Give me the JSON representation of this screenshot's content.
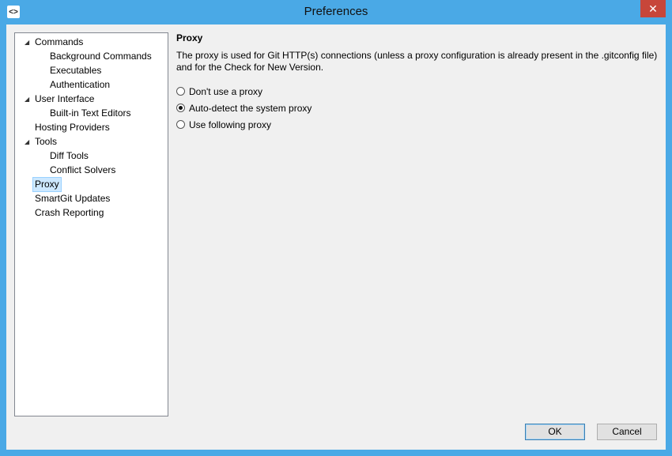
{
  "window": {
    "title": "Preferences",
    "app_icon_glyph": "<>",
    "close_glyph": "✕"
  },
  "tree": {
    "items": [
      {
        "label": "Commands",
        "toggle": "◢"
      },
      {
        "label": "Background Commands"
      },
      {
        "label": "Executables"
      },
      {
        "label": "Authentication"
      },
      {
        "label": "User Interface",
        "toggle": "◢"
      },
      {
        "label": "Built-in Text Editors"
      },
      {
        "label": "Hosting Providers"
      },
      {
        "label": "Tools",
        "toggle": "◢"
      },
      {
        "label": "Diff Tools"
      },
      {
        "label": "Conflict Solvers"
      },
      {
        "label": "Proxy",
        "selected": true
      },
      {
        "label": "SmartGit Updates"
      },
      {
        "label": "Crash Reporting"
      }
    ]
  },
  "proxy": {
    "title": "Proxy",
    "description": "The proxy is used for Git HTTP(s) connections (unless a proxy configuration is already present in the .gitconfig file) and for the Check for New Version.",
    "options": [
      {
        "label": "Don't use a proxy",
        "checked": false
      },
      {
        "label": "Auto-detect the system proxy",
        "checked": true
      },
      {
        "label": "Use following proxy",
        "checked": false
      }
    ]
  },
  "buttons": {
    "ok": "OK",
    "cancel": "Cancel"
  },
  "colors": {
    "titlebar": "#4aa9e6",
    "close": "#c7463a",
    "selection": "#cce8ff"
  }
}
